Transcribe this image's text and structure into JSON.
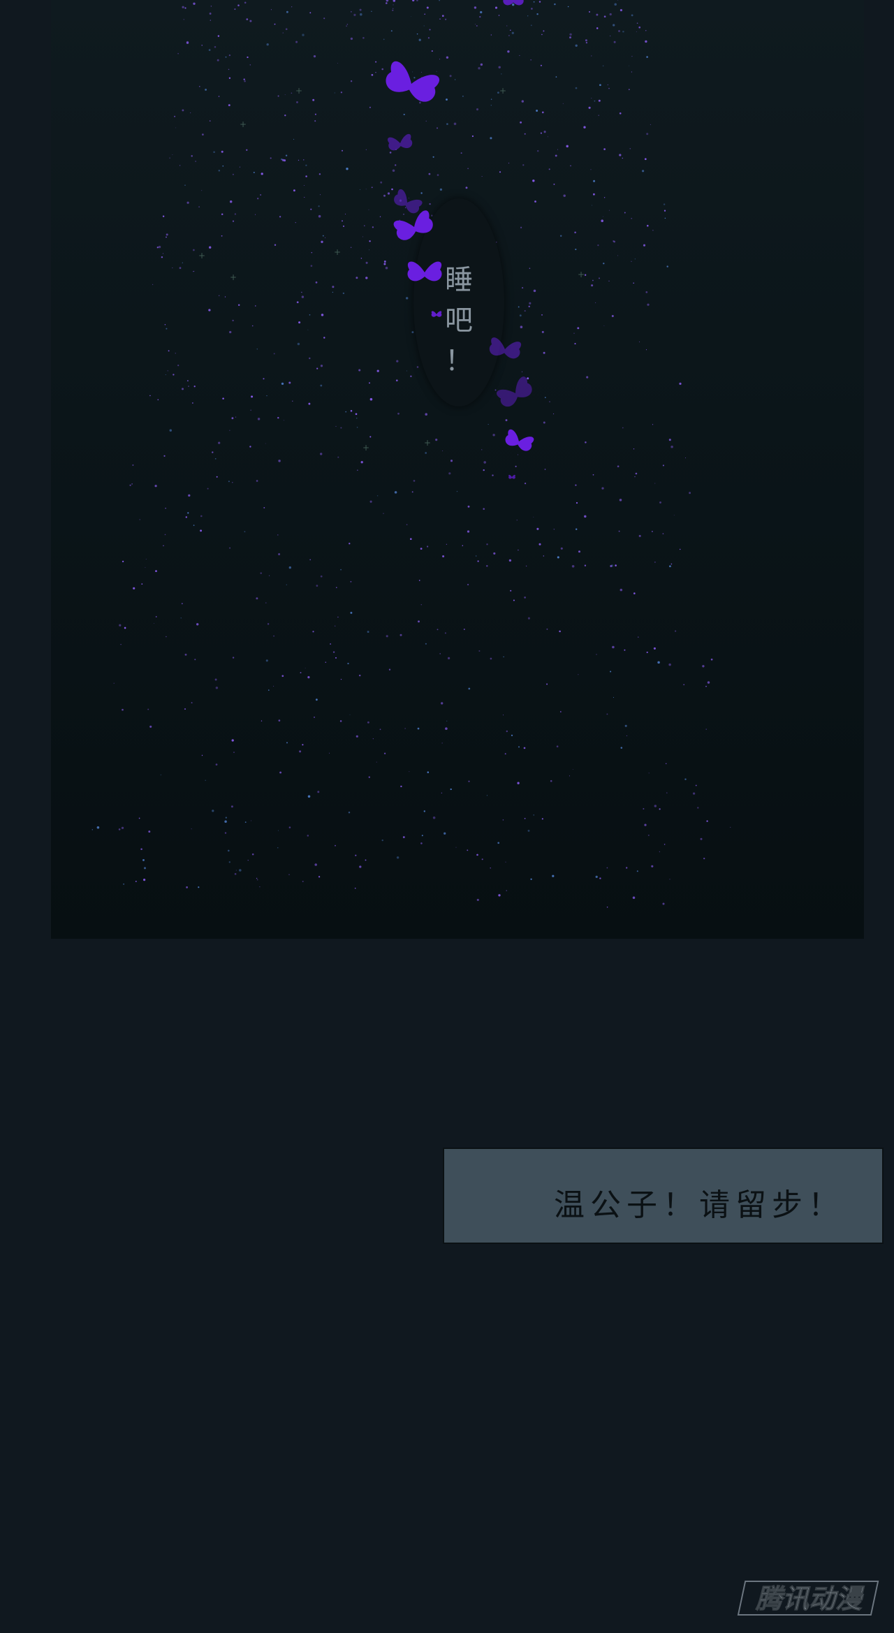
{
  "panel": {
    "speech_bubble": {
      "lines": [
        "睡",
        "吧",
        "！"
      ]
    },
    "butterfly_color": "#6a1fe0",
    "sparkle_color": "#8a5cf0"
  },
  "caption": {
    "text": "温公子！请留步！"
  },
  "watermark": {
    "text": "腾讯动漫"
  },
  "colors": {
    "background": "#10181f",
    "caption_box": "#3f4f5a",
    "caption_text": "#0b1114",
    "speech_text": "#8a96a0"
  }
}
